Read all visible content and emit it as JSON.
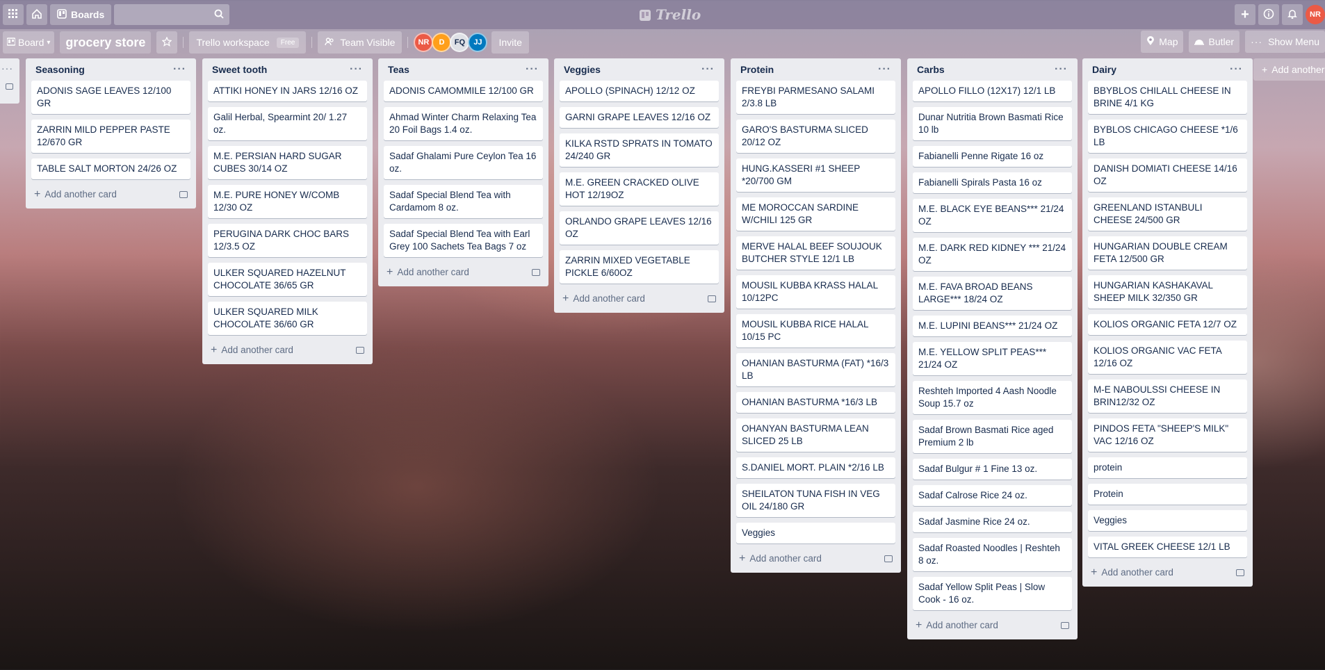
{
  "topbar": {
    "boards_label": "Boards",
    "logo_text": "Trello",
    "user_initials": "NR",
    "user_color": "#eb5a46"
  },
  "boardbar": {
    "view_label": "Board",
    "board_name": "grocery store",
    "workspace_label": "Trello workspace",
    "workspace_badge": "Free",
    "visibility_label": "Team Visible",
    "members": [
      {
        "initials": "NR",
        "color": "#eb5a46"
      },
      {
        "initials": "D",
        "color": "#ff9f1a"
      },
      {
        "initials": "FQ",
        "color": "#dfe1e6"
      },
      {
        "initials": "JJ",
        "color": "#0079bf"
      }
    ],
    "invite_label": "Invite",
    "map_label": "Map",
    "butler_label": "Butler",
    "menu_label": "Show Menu"
  },
  "add_card_label": "Add another card",
  "add_list_label": "Add another",
  "lists": [
    {
      "title": "Seasoning",
      "cards": [
        "ADONIS SAGE LEAVES 12/100 GR",
        "ZARRIN MILD PEPPER PASTE 12/670 GR",
        "TABLE SALT MORTON 24/26 OZ"
      ]
    },
    {
      "title": "Sweet tooth",
      "cards": [
        "ATTIKI HONEY IN JARS 12/16 OZ",
        "Galil Herbal, Spearmint 20/ 1.27 oz.",
        "M.E. PERSIAN HARD SUGAR CUBES 30/14 OZ",
        "M.E. PURE HONEY W/COMB 12/30 OZ",
        "PERUGINA DARK CHOC BARS 12/3.5 OZ",
        "ULKER SQUARED HAZELNUT CHOCOLATE 36/65 GR",
        "ULKER SQUARED MILK CHOCOLATE 36/60 GR"
      ]
    },
    {
      "title": "Teas",
      "cards": [
        "ADONIS CAMOMMILE 12/100 GR",
        "Ahmad Winter Charm Relaxing Tea 20 Foil Bags 1.4 oz.",
        "Sadaf Ghalami Pure Ceylon Tea 16 oz.",
        "Sadaf Special Blend Tea with Cardamom 8 oz.",
        "Sadaf Special Blend Tea with Earl Grey 100 Sachets Tea Bags 7 oz"
      ]
    },
    {
      "title": "Veggies",
      "cards": [
        "APOLLO (SPINACH) 12/12 OZ",
        "GARNI GRAPE LEAVES 12/16 OZ",
        "KILKA RSTD SPRATS IN TOMATO 24/240 GR",
        "M.E. GREEN CRACKED OLIVE HOT 12/19OZ",
        "ORLANDO GRAPE LEAVES 12/16 OZ",
        "ZARRIN MIXED VEGETABLE PICKLE 6/60OZ"
      ]
    },
    {
      "title": "Protein",
      "cards": [
        "FREYBI PARMESANO SALAMI 2/3.8 LB",
        "GARO'S BASTURMA SLICED 20/12 OZ",
        "HUNG.KASSERI #1 SHEEP *20/700 GM",
        "ME MOROCCAN SARDINE W/CHILI 125 GR",
        "MERVE HALAL BEEF SOUJOUK BUTCHER STYLE 12/1 LB",
        "MOUSIL KUBBA KRASS HALAL 10/12PC",
        "MOUSIL KUBBA RICE HALAL 10/15 PC",
        "OHANIAN BASTURMA (FAT) *16/3 LB",
        "OHANIAN BASTURMA *16/3 LB",
        "OHANYAN BASTURMA LEAN SLICED 25 LB",
        "S.DANIEL MORT. PLAIN *2/16 LB",
        "SHEILATON TUNA FISH IN VEG OIL 24/180 GR",
        "Veggies"
      ]
    },
    {
      "title": "Carbs",
      "cards": [
        "APOLLO FILLO (12X17) 12/1 LB",
        "Dunar Nutritia Brown Basmati Rice 10 lb",
        "Fabianelli Penne Rigate 16 oz",
        "Fabianelli Spirals Pasta 16 oz",
        "M.E. BLACK EYE BEANS*** 21/24 OZ",
        "M.E. DARK RED KIDNEY *** 21/24 OZ",
        "M.E. FAVA BROAD BEANS LARGE*** 18/24 OZ",
        "M.E. LUPINI BEANS*** 21/24 OZ",
        "M.E. YELLOW SPLIT PEAS*** 21/24 OZ",
        "Reshteh Imported 4 Aash Noodle Soup 15.7 oz",
        "Sadaf Brown Basmati Rice aged Premium 2 lb",
        "Sadaf Bulgur # 1 Fine 13 oz.",
        "Sadaf Calrose Rice 24 oz.",
        "Sadaf Jasmine Rice 24 oz.",
        "Sadaf Roasted Noodles | Reshteh 8 oz.",
        "Sadaf Yellow Split Peas | Slow Cook - 16 oz."
      ]
    },
    {
      "title": "Dairy",
      "cards": [
        "BBYBLOS CHILALL CHEESE IN BRINE 4/1 KG",
        "BYBLOS CHICAGO CHEESE *1/6 LB",
        "DANISH DOMIATI CHEESE 14/16 OZ",
        "GREENLAND ISTANBULI CHEESE 24/500 GR",
        "HUNGARIAN DOUBLE CREAM FETA 12/500 GR",
        "HUNGARIAN KASHAKAVAL SHEEP MILK 32/350 GR",
        "KOLIOS ORGANIC FETA 12/7 OZ",
        "KOLIOS ORGANIC VAC FETA 12/16 OZ",
        "M-E NABOULSSI CHEESE IN BRIN12/32 OZ",
        "PINDOS FETA \"SHEEP'S MILK\" VAC 12/16 OZ",
        "protein",
        "Protein",
        "Veggies",
        "VITAL GREEK CHEESE 12/1 LB"
      ]
    }
  ]
}
